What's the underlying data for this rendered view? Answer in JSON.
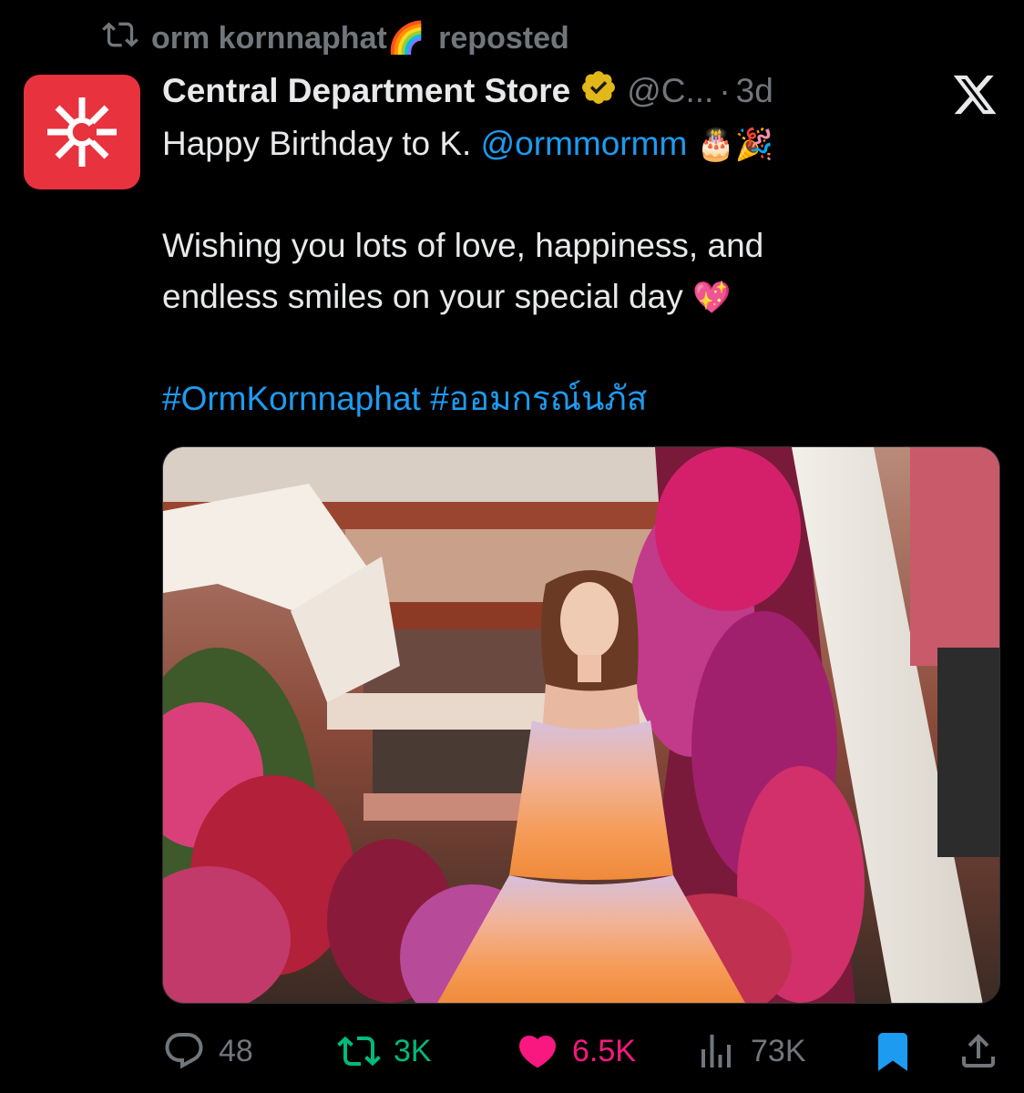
{
  "repost_banner": {
    "user": "orm kornnaphat",
    "user_emoji": "🌈",
    "label": "reposted"
  },
  "author": {
    "display_name": "Central Department Store",
    "verified": true,
    "handle": "@C...",
    "separator": "·",
    "time": "3d",
    "avatar_icon": "central-logo-icon"
  },
  "tweet": {
    "line1_text": "Happy Birthday to K. ",
    "line1_mention": "@ormmormm",
    "line1_emoji": "🎂🎉",
    "line2": "Wishing you lots of love, happiness, and",
    "line3_text": "endless smiles on your special day ",
    "line3_emoji": "💖",
    "hashtags": [
      "#OrmKornnaphat",
      "#ออมกรณ์นภัส"
    ]
  },
  "actions": {
    "replies": "48",
    "reposts": "3K",
    "likes": "6.5K",
    "views": "73K"
  },
  "colors": {
    "background": "#000000",
    "text": "#e7e9ea",
    "muted": "#71767b",
    "link": "#1d9bf0",
    "repost_active": "#00ba7c",
    "like_active": "#f91880",
    "avatar_bg": "#e8323e",
    "verified_badge": "#e2b719"
  }
}
